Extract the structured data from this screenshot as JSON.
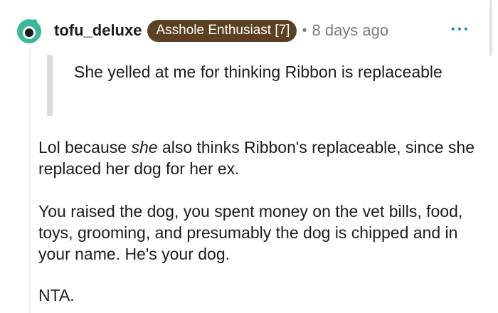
{
  "comment": {
    "username": "tofu_deluxe",
    "flair": "Asshole Enthusiast [7]",
    "separator": "•",
    "timestamp": "8 days ago",
    "menu_label": "···",
    "quote": "She yelled at me for thinking Ribbon is replaceable",
    "paragraph1": {
      "before": "Lol because ",
      "emphasis": "she",
      "after": " also thinks Ribbon's replaceable, since she replaced her dog for her ex."
    },
    "paragraph2": "You raised the dog, you spent money on the vet bills, food, toys, grooming, and presumably the dog is chipped and in your name. He's your dog.",
    "paragraph3": "NTA."
  },
  "colors": {
    "flair_bg": "#5b4121",
    "avatar": "#3bb89a",
    "menu": "#0079d3",
    "meta_text": "#7c7c7c"
  },
  "icons": {
    "avatar": "snoo-avatar-icon",
    "menu": "more-options-icon"
  }
}
